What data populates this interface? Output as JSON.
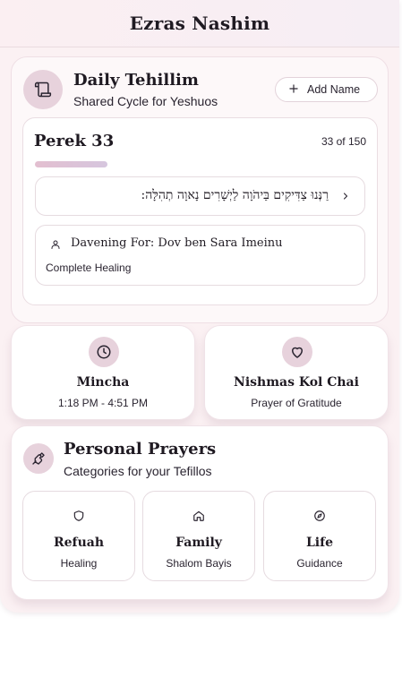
{
  "app": {
    "title": "Ezras Nashim"
  },
  "tehillim": {
    "title": "Daily Tehillim",
    "subtitle": "Shared Cycle for Yeshuos",
    "add_name_label": "Add Name",
    "perek_title": "Perek 33",
    "perek_count": "33 of 150",
    "progress_fraction": 0.22,
    "verse": "רַנְּנוּ צַדִּיקִים בַּיהֹוָה לַיְשָׁרִים נָאוָה תְהִלָּה:",
    "davening_for": "Davening For: Dov ben Sara Imeinu",
    "davening_reason": "Complete Healing"
  },
  "mincha": {
    "title": "Mincha",
    "time": "1:18 PM - 4:51 PM"
  },
  "nishmas": {
    "title": "Nishmas Kol Chai",
    "subtitle": "Prayer of Gratitude"
  },
  "personal_prayers": {
    "title": "Personal Prayers",
    "subtitle": "Categories for your Tefillos",
    "categories": [
      {
        "title": "Refuah",
        "subtitle": "Healing",
        "icon": "shield-icon"
      },
      {
        "title": "Family",
        "subtitle": "Shalom Bayis",
        "icon": "home-icon"
      },
      {
        "title": "Life",
        "subtitle": "Guidance",
        "icon": "compass-icon"
      }
    ]
  },
  "colors": {
    "background": "#fbf1f3",
    "accent": "#e7d2dc",
    "progress": "#e3bfd0"
  }
}
